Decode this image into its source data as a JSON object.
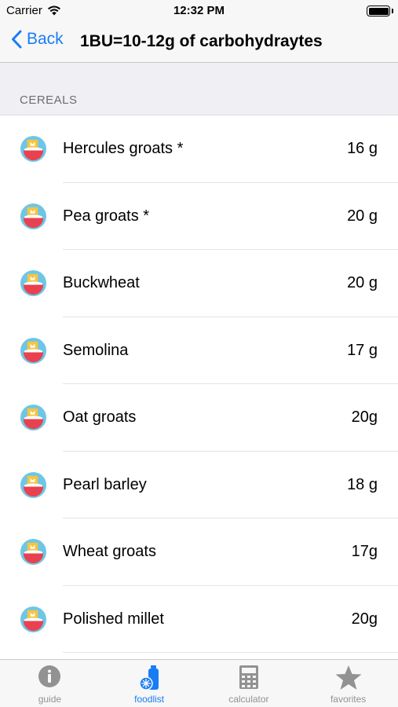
{
  "status_bar": {
    "carrier": "Carrier",
    "time": "12:32 PM"
  },
  "nav": {
    "back_label": "Back",
    "title": "1BU=10-12g of carbohydraytes"
  },
  "section": {
    "title": "CEREALS"
  },
  "items": [
    {
      "name": "Hercules groats *",
      "value": "16 g"
    },
    {
      "name": "Pea groats *",
      "value": "20 g"
    },
    {
      "name": "Buckwheat",
      "value": "20 g"
    },
    {
      "name": "Semolina",
      "value": "17 g"
    },
    {
      "name": "Oat groats",
      "value": "20g"
    },
    {
      "name": "Pearl barley",
      "value": "18 g"
    },
    {
      "name": "Wheat groats",
      "value": "17g"
    },
    {
      "name": "Polished millet",
      "value": "20g"
    },
    {
      "name": "",
      "value": ""
    }
  ],
  "tabs": [
    {
      "label": "guide",
      "icon": "info-icon"
    },
    {
      "label": "foodlist",
      "icon": "bottle-icon",
      "active": true
    },
    {
      "label": "calculator",
      "icon": "calculator-icon"
    },
    {
      "label": "favorites",
      "icon": "star-icon"
    }
  ],
  "colors": {
    "accent": "#1a7cf5",
    "inactive": "#929292",
    "icon_yellow": "#f5c542",
    "icon_red": "#e8414f",
    "icon_blue": "#6ec6e6"
  }
}
